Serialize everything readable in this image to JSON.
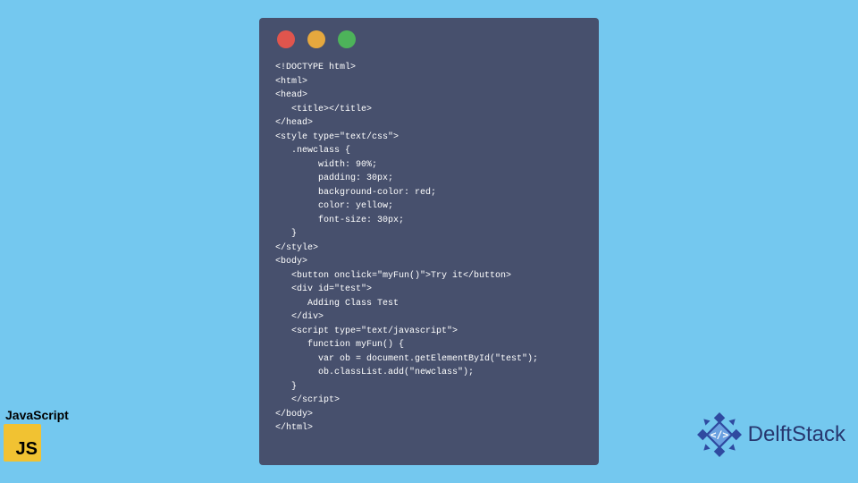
{
  "window": {
    "dots": [
      "red",
      "yellow",
      "green"
    ]
  },
  "code": {
    "lines": [
      "<!DOCTYPE html>",
      "<html>",
      "<head>",
      "   <title></title>",
      "</head>",
      "<style type=\"text/css\">",
      "   .newclass {",
      "        width: 90%;",
      "        padding: 30px;",
      "        background-color: red;",
      "        color: yellow;",
      "        font-size: 30px;",
      "   }",
      "</style>",
      "<body>",
      "   <button onclick=\"myFun()\">Try it</button>",
      "   <div id=\"test\">",
      "      Adding Class Test",
      "   </div>",
      "   <script type=\"text/javascript\">",
      "      function myFun() {",
      "        var ob = document.getElementById(\"test\");",
      "        ob.classList.add(\"newclass\");",
      "   }",
      "   </script>",
      "</body>",
      "</html>"
    ]
  },
  "js_badge": {
    "label": "JavaScript",
    "icon_text": "JS"
  },
  "brand": {
    "name": "DelftStack",
    "logo_color": "#2f4aa0"
  }
}
